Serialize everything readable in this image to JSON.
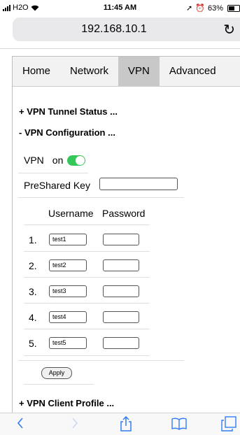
{
  "status_bar": {
    "carrier": "H2O",
    "time": "11:45 AM",
    "battery": "63%",
    "battery_level": 0.63
  },
  "address_bar": {
    "url": "192.168.10.1"
  },
  "tabs": [
    {
      "label": "Home"
    },
    {
      "label": "Network"
    },
    {
      "label": "VPN",
      "active": true
    },
    {
      "label": "Advanced"
    }
  ],
  "sections": {
    "tunnel_status": "+ VPN Tunnel Status ...",
    "configuration": "- VPN Configuration ...",
    "client_profile": "+ VPN Client Profile ..."
  },
  "vpn": {
    "label": "VPN",
    "state": "on",
    "enabled": true
  },
  "preshared_key": {
    "label": "PreShared Key",
    "value": ""
  },
  "users_table": {
    "headers": [
      "Username",
      "Password"
    ],
    "rows": [
      {
        "num": "1.",
        "username": "test1",
        "password": ""
      },
      {
        "num": "2.",
        "username": "test2",
        "password": ""
      },
      {
        "num": "3.",
        "username": "test3",
        "password": ""
      },
      {
        "num": "4.",
        "username": "test4",
        "password": ""
      },
      {
        "num": "5.",
        "username": "test5",
        "password": ""
      }
    ]
  },
  "apply_label": "Apply",
  "colors": {
    "accent": "#2f7cf6",
    "toggle_on": "#34c759",
    "active_tab": "#c8c8c8"
  },
  "toolbar_icons": [
    "back-icon",
    "forward-icon",
    "share-icon",
    "bookmarks-icon",
    "tabs-icon"
  ]
}
